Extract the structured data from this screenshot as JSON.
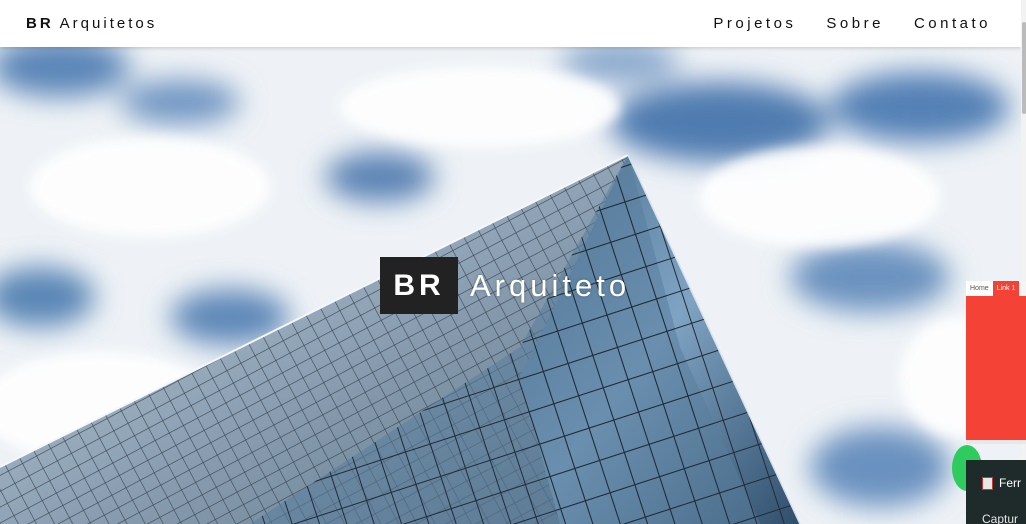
{
  "navbar": {
    "brand_strong": "BR",
    "brand_rest": "Arquitetos",
    "links": [
      "Projetos",
      "Sobre",
      "Contato"
    ]
  },
  "hero": {
    "logo_box": "BR",
    "logo_text": "Arquiteto"
  },
  "extension_panel": {
    "tabs": [
      "Home",
      "Link 1"
    ]
  },
  "taskbar_popup": {
    "app_label": "Ferr",
    "capture_label": "Captur"
  },
  "colors": {
    "sky": "#9ab8d6",
    "logo_box": "#222222",
    "extension_red": "#f44336",
    "popup_bg": "#1f2a2a",
    "green_button": "#2ecc5e"
  }
}
